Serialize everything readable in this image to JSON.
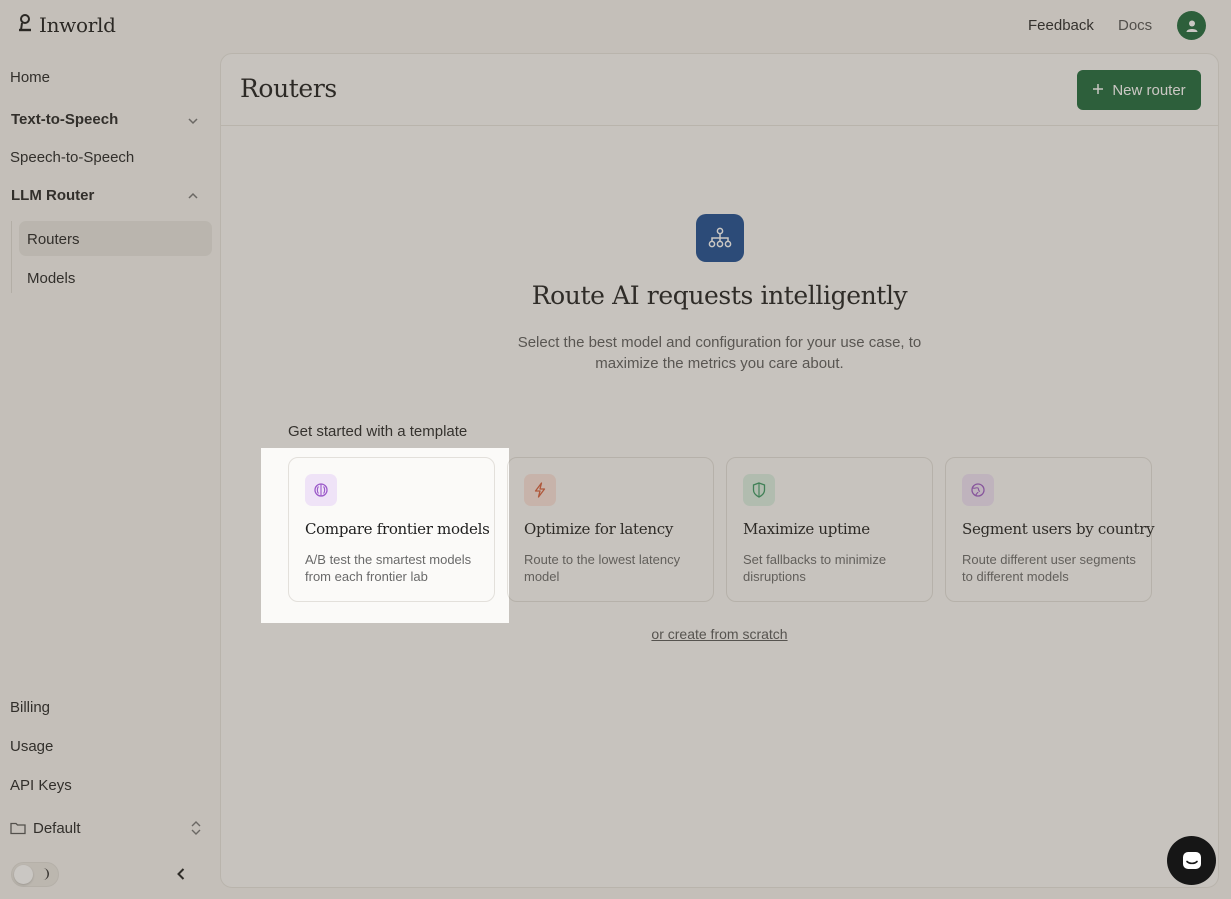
{
  "header": {
    "logo_text": "Inworld",
    "feedback_label": "Feedback",
    "docs_label": "Docs"
  },
  "sidebar": {
    "home": "Home",
    "text_to_speech": "Text-to-Speech",
    "speech_to_speech": "Speech-to-Speech",
    "llm_router": "LLM Router",
    "llm_router_items": [
      "Routers",
      "Models"
    ],
    "active_item": "Routers",
    "billing": "Billing",
    "usage": "Usage",
    "api_keys": "API Keys",
    "workspace": "Default"
  },
  "main": {
    "title": "Routers",
    "new_router_label": "New router",
    "hero_title": "Route AI requests intelligently",
    "hero_description": "Select the best model and configuration for your use case, to maximize the metrics you care about.",
    "templates_label": "Get started with a template",
    "templates": [
      {
        "title": "Compare frontier models",
        "description": "A/B test the smartest models from each frontier lab",
        "icon": "brain-icon",
        "icon_bg": "#efe3f7",
        "icon_color": "#9b59c9"
      },
      {
        "title": "Optimize for latency",
        "description": "Route to the lowest latency model",
        "icon": "lightning-icon",
        "icon_bg": "#fbe3dc",
        "icon_color": "#d9603d"
      },
      {
        "title": "Maximize uptime",
        "description": "Set fallbacks to minimize disruptions",
        "icon": "shield-icon",
        "icon_bg": "#dcefe3",
        "icon_color": "#3a9a64"
      },
      {
        "title": "Segment users by country",
        "description": "Route different user segments to different models",
        "icon": "globe-icon",
        "icon_bg": "#efe3f7",
        "icon_color": "#a05cc7"
      }
    ],
    "scratch_link": "or create from scratch"
  },
  "colors": {
    "brand_green": "#1f6a3d",
    "hero_icon_bg": "#1d4e94"
  }
}
